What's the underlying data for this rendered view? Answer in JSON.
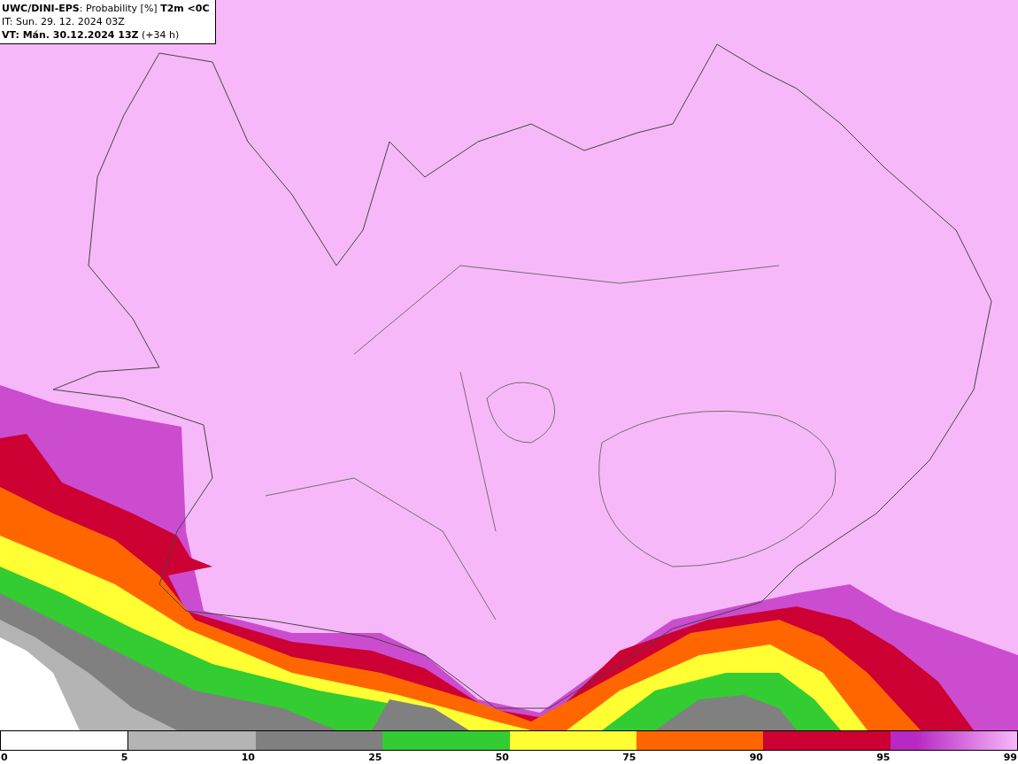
{
  "header": {
    "lines": [
      "**UWC/DINI-EPS**: Probability [%] **T2m <0C**",
      "IT: Sun. 29. 12. 2024 03Z",
      "**VT: Mán. 30.12.2024 13Z** (+34 h)"
    ]
  },
  "legend": {
    "segments": [
      {
        "color": "#ffffff"
      },
      {
        "color": "#b4b4b4"
      },
      {
        "color": "#808080"
      },
      {
        "color": "#33cc33"
      },
      {
        "color": "#ffff33"
      },
      {
        "color": "#ff6600"
      },
      {
        "color": "#cc0033"
      },
      {
        "color": "#b828c4"
      }
    ],
    "labels": [
      "0",
      "5",
      "10",
      "25",
      "50",
      "75",
      "90",
      "95",
      "99"
    ]
  }
}
